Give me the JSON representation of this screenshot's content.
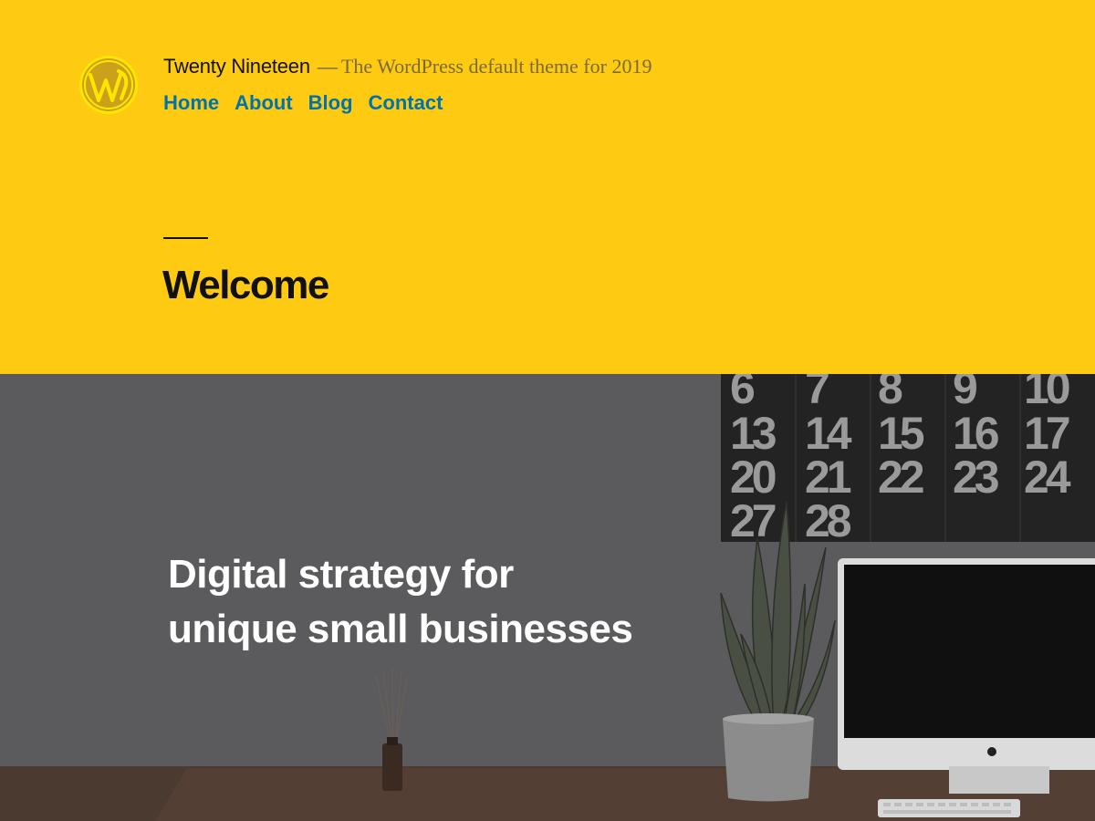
{
  "site": {
    "title": "Twenty Nineteen",
    "separator": "—",
    "description": "The WordPress default theme for 2019",
    "logo_icon": "wordpress-logo-icon"
  },
  "nav": {
    "items": [
      {
        "label": "Home"
      },
      {
        "label": "About"
      },
      {
        "label": "Blog"
      },
      {
        "label": "Contact"
      }
    ]
  },
  "page": {
    "title": "Welcome"
  },
  "cover": {
    "heading_line1": "Digital strategy for",
    "heading_line2": "unique small businesses",
    "calendar_numbers": [
      [
        "6",
        "7",
        "8",
        "9",
        "10"
      ],
      [
        "13",
        "14",
        "15",
        "16",
        "17"
      ],
      [
        "20",
        "21",
        "22",
        "23",
        "24"
      ],
      [
        "27",
        "28",
        "",
        "",
        ""
      ]
    ]
  },
  "colors": {
    "header_bg": "#ffca12",
    "link": "#0073aa",
    "text": "#111111",
    "cover_overlay": "#5b5b5d"
  }
}
